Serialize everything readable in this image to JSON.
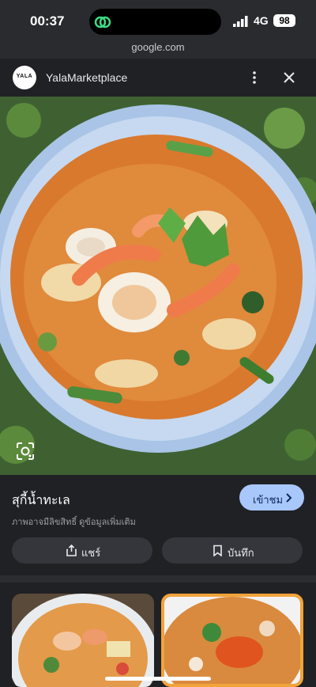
{
  "status_bar": {
    "time": "00:37",
    "network": "4G",
    "battery": "98"
  },
  "url_bar": {
    "domain": "google.com"
  },
  "header": {
    "logo_text": "YALA",
    "site_name": "YalaMarketplace"
  },
  "result": {
    "title": "สุกี้น้ำทะเล",
    "subtitle": "ภาพอาจมีลิขสิทธิ์ ดูข้อมูลเพิ่มเติม",
    "visit_label": "เข้าชม",
    "share_label": "แชร์",
    "save_label": "บันทึก"
  },
  "colors": {
    "accent": "#a8c7fa",
    "selected_border": "#f2a33a",
    "background": "#202124"
  },
  "icons": [
    "google-app-icon",
    "signal-icon",
    "more-vert-icon",
    "close-icon",
    "google-lens-icon",
    "chevron-right-icon",
    "share-icon",
    "bookmark-icon"
  ]
}
